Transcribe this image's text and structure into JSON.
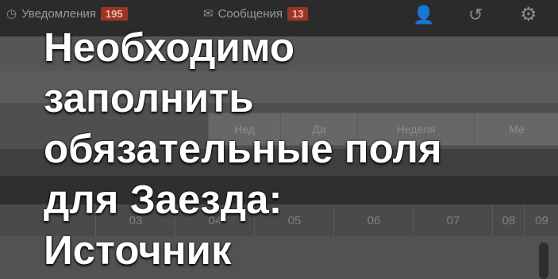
{
  "topbar": {
    "notifications_label": "Уведомления",
    "notifications_count": "195",
    "messages_label": "Сообщения",
    "messages_count": "13"
  },
  "tabs": [
    "Нед",
    "Да",
    "Неделя",
    "Ме"
  ],
  "hours": [
    "03",
    "04",
    "05",
    "06",
    "07",
    "08",
    "09"
  ],
  "overlay": {
    "line1": "Необходимо",
    "line2": "заполнить",
    "line3": "обязательные поля",
    "line4": "для Заезда:",
    "line5": "Источник"
  },
  "colors": {
    "badge": "#9b3523",
    "overlay_text": "#ffffff"
  }
}
